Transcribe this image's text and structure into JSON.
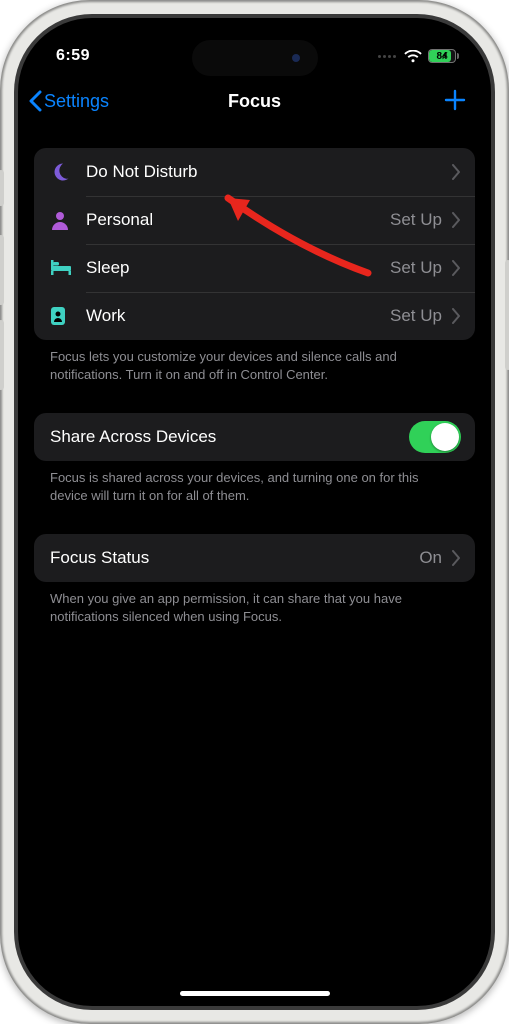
{
  "status": {
    "time": "6:59",
    "battery_percent": "84"
  },
  "nav": {
    "back_label": "Settings",
    "title": "Focus"
  },
  "focus_modes": [
    {
      "label": "Do Not Disturb",
      "trailing": "",
      "icon": "moon",
      "icon_color": "#7d5bd9"
    },
    {
      "label": "Personal",
      "trailing": "Set Up",
      "icon": "person",
      "icon_color": "#b05bd9"
    },
    {
      "label": "Sleep",
      "trailing": "Set Up",
      "icon": "bed",
      "icon_color": "#3fd1c2"
    },
    {
      "label": "Work",
      "trailing": "Set Up",
      "icon": "badge",
      "icon_color": "#3fd1c2"
    }
  ],
  "footer1": "Focus lets you customize your devices and silence calls and notifications. Turn it on and off in Control Center.",
  "share_row": {
    "label": "Share Across Devices",
    "enabled": true
  },
  "footer2": "Focus is shared across your devices, and turning one on for this device will turn it on for all of them.",
  "status_row": {
    "label": "Focus Status",
    "value": "On"
  },
  "footer3": "When you give an app permission, it can share that you have notifications silenced when using Focus.",
  "colors": {
    "accent_blue": "#0a84ff",
    "green": "#30d158",
    "arrow_red": "#e8261d"
  }
}
